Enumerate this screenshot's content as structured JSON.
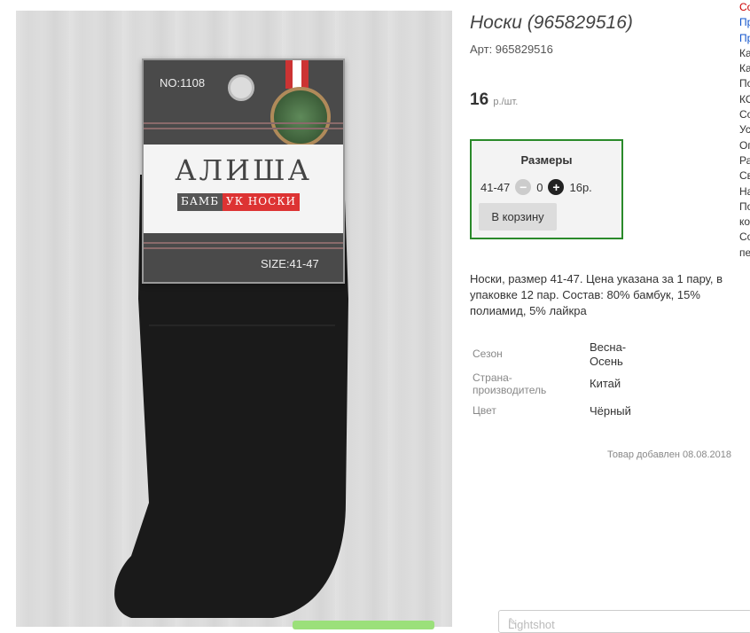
{
  "product": {
    "title": "Носки (965829516)",
    "article": "Арт: 965829516",
    "price_value": "16",
    "price_unit": "р./шт."
  },
  "package_tag": {
    "model": "NO:1108",
    "brand": "АЛИША",
    "band_left": "БАМБ",
    "band_right": "УК НОСКИ",
    "size": "SIZE:41-47"
  },
  "sizes": {
    "header": "Размеры",
    "size": "41-47",
    "quantity": "0",
    "subtotal": "16р.",
    "cart_button": "В корзину"
  },
  "description": "Носки, размер 41-47. Цена указана за 1 пару, в упаковке 12 пар. Состав: 80% бамбук, 15% полиамид, 5% лайкра",
  "properties": [
    {
      "key": "Сезон",
      "value": "Весна-Осень"
    },
    {
      "key": "Страна-производитель",
      "value": "Китай"
    },
    {
      "key": "Цвет",
      "value": "Чёрный"
    }
  ],
  "added": "Товар добавлен 08.08.2018",
  "right_column": [
    "Со",
    "Пр",
    "Пр",
    "Ка",
    "Ка",
    "По",
    "КО",
    "Со",
    "Ус",
    "Оп",
    "Ра",
    "Св",
    "На",
    "По",
    "ко",
    "Со",
    "пе"
  ],
  "lightshot": {
    "label": "Lightshot"
  },
  "colors": {
    "accent_border": "#2a8a2a",
    "link": "#1155cc",
    "alert": "#cc0000"
  }
}
